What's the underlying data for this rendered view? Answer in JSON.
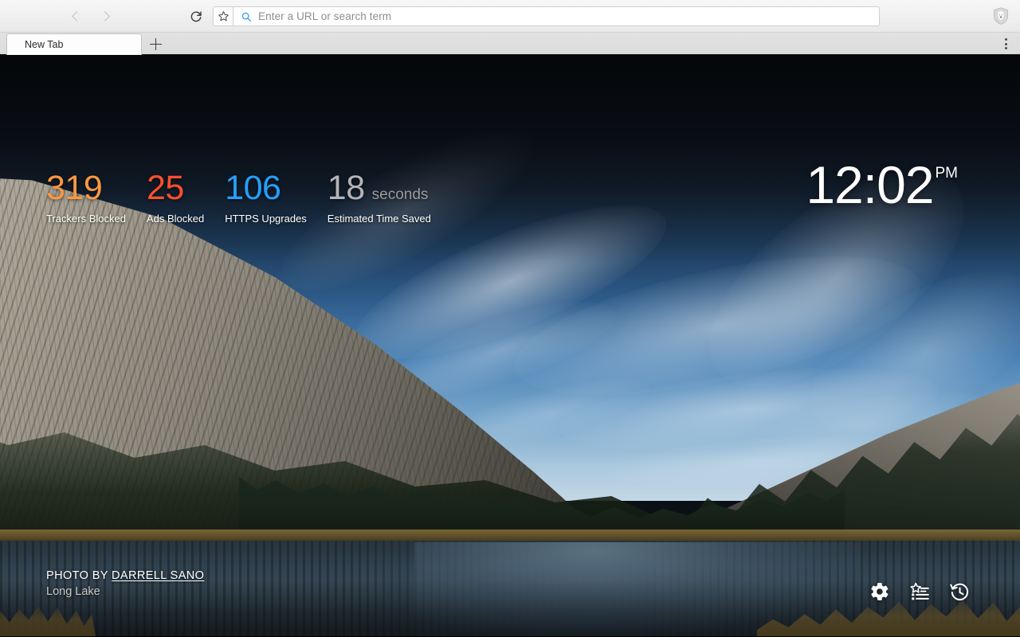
{
  "browser": {
    "toolbar": {
      "back_icon": "chevron-left-icon",
      "forward_icon": "chevron-right-icon",
      "reload_icon": "reload-icon",
      "bookmark_icon": "star-icon",
      "brand_icon": "brave-lion-shield-icon"
    },
    "urlbar": {
      "placeholder": "Enter a URL or search term",
      "value": "",
      "search_icon": "search-icon"
    },
    "tabstrip": {
      "tabs": [
        {
          "title": "New Tab",
          "active": true
        }
      ],
      "new_tab_label": "+",
      "new_tab_icon": "plus-icon",
      "menu_icon": "vertical-dots-icon"
    }
  },
  "newtab": {
    "stats": [
      {
        "value": "319",
        "suffix": "",
        "label": "Trackers Blocked",
        "color": "#fb9840"
      },
      {
        "value": "25",
        "suffix": "",
        "label": "Ads Blocked",
        "color": "#fc4f2c"
      },
      {
        "value": "106",
        "suffix": "",
        "label": "HTTPS Upgrades",
        "color": "#24a0fc"
      },
      {
        "value": "18",
        "suffix": "seconds",
        "label": "Estimated Time Saved",
        "color": "#b4b4b8"
      }
    ],
    "clock": {
      "time": "12:02",
      "period": "PM"
    },
    "credit": {
      "prefix": "PHOTO BY",
      "author": "DARRELL SANO",
      "location": "Long Lake"
    },
    "shortcuts": [
      {
        "name": "settings",
        "icon": "gear-icon"
      },
      {
        "name": "bookmarks",
        "icon": "bookmarks-list-icon"
      },
      {
        "name": "history",
        "icon": "history-clock-icon"
      }
    ]
  }
}
